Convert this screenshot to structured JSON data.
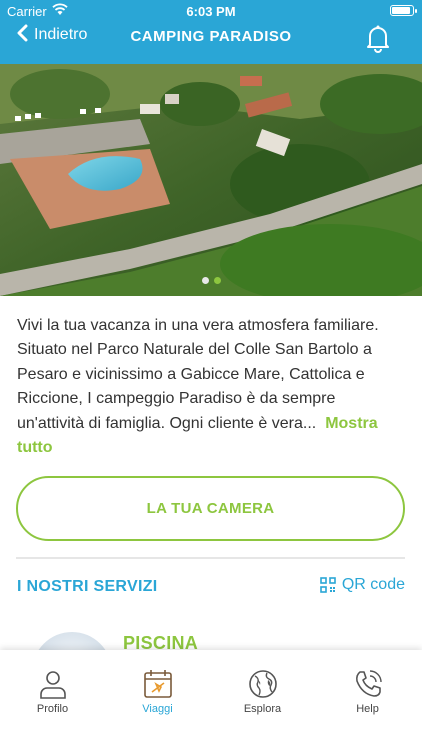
{
  "status_bar": {
    "carrier": "Carrier",
    "time": "6:03 PM",
    "battery_level": 0.95
  },
  "nav": {
    "back_label": "Indietro",
    "title": "CAMPING PARADISO"
  },
  "hero": {
    "slides_count": 2,
    "active_slide": 2
  },
  "description": {
    "text": "Vivi la tua vacanza in una vera atmosfera familiare. Situato nel Parco Naturale del Colle San Bartolo a Pesaro e vicinissimo a Gabicce Mare, Cattolica e Riccione, I campeggio Paradiso è da sempre un'attività di famiglia. Ogni cliente è vera...",
    "more_label": "Mostra tutto"
  },
  "cta": {
    "label": "LA TUA CAMERA"
  },
  "services": {
    "title": "I NOSTRI SERVIZI",
    "qr_label": "QR code",
    "items": [
      {
        "title": "PISCINA"
      }
    ]
  },
  "tabs": [
    {
      "label": "Profilo",
      "icon": "user-icon"
    },
    {
      "label": "Viaggi",
      "icon": "calendar-plane-icon",
      "active": true
    },
    {
      "label": "Esplora",
      "icon": "globe-icon"
    },
    {
      "label": "Help",
      "icon": "phone-icon"
    }
  ],
  "colors": {
    "primary": "#2aa6d6",
    "accent": "#8dc63f",
    "text": "#333333"
  }
}
